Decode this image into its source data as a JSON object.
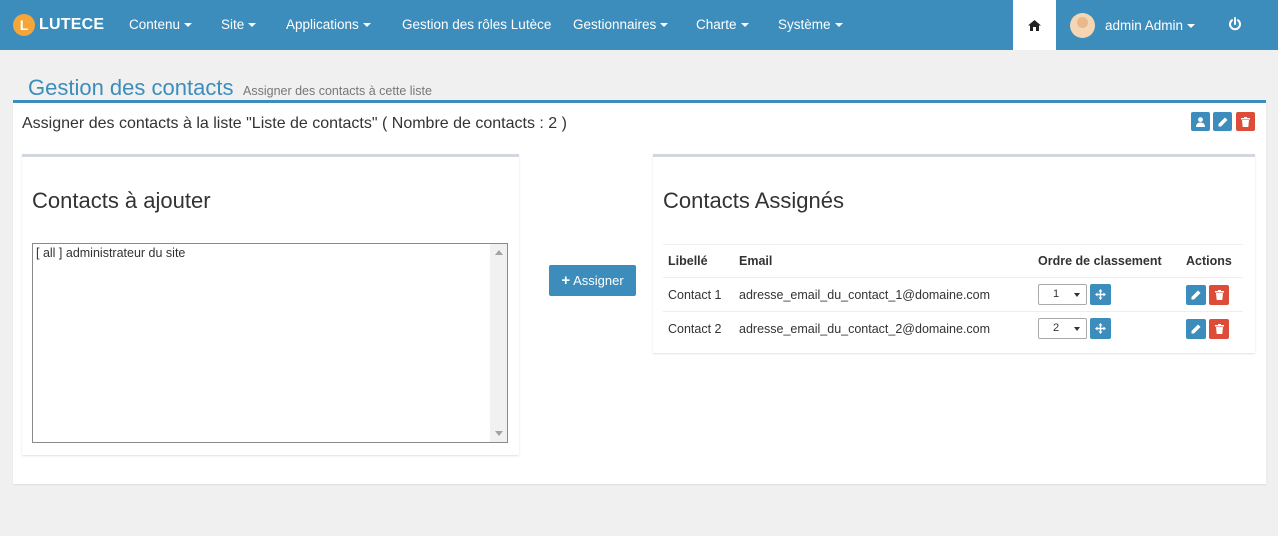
{
  "navbar": {
    "brand_logo": "L",
    "brand": "LUTECE",
    "items": [
      {
        "label": "Contenu",
        "has_caret": true
      },
      {
        "label": "Site",
        "has_caret": true
      },
      {
        "label": "Applications",
        "has_caret": true
      },
      {
        "label": "Gestion des rôles Lutèce",
        "has_caret": false
      },
      {
        "label": "Gestionnaires",
        "has_caret": true
      },
      {
        "label": "Charte",
        "has_caret": true
      },
      {
        "label": "Système",
        "has_caret": true
      }
    ],
    "home_icon": "home-icon",
    "user_label": "admin Admin",
    "power_icon": "power-icon"
  },
  "page": {
    "title": "Gestion des contacts",
    "subtitle": "Assigner des contacts à cette liste"
  },
  "box": {
    "title": "Assigner des contacts à la liste \"Liste de contacts\" ( Nombre de contacts : 2 )",
    "tools": [
      "user-icon",
      "pencil-icon",
      "trash-icon"
    ]
  },
  "left_panel": {
    "title": "Contacts à ajouter",
    "options": [
      "[ all ] administrateur du site"
    ]
  },
  "assign_button": {
    "icon": "+",
    "label": "Assigner"
  },
  "right_panel": {
    "title": "Contacts Assignés",
    "columns": [
      "Libellé",
      "Email",
      "Ordre de classement",
      "Actions"
    ],
    "rows": [
      {
        "label": "Contact 1",
        "email": "adresse_email_du_contact_1@domaine.com",
        "order": "1"
      },
      {
        "label": "Contact 2",
        "email": "adresse_email_du_contact_2@domaine.com",
        "order": "2"
      }
    ]
  },
  "colors": {
    "primary": "#3c8dbc",
    "danger": "#dd4b39",
    "brand_logo": "#f4a63a"
  }
}
